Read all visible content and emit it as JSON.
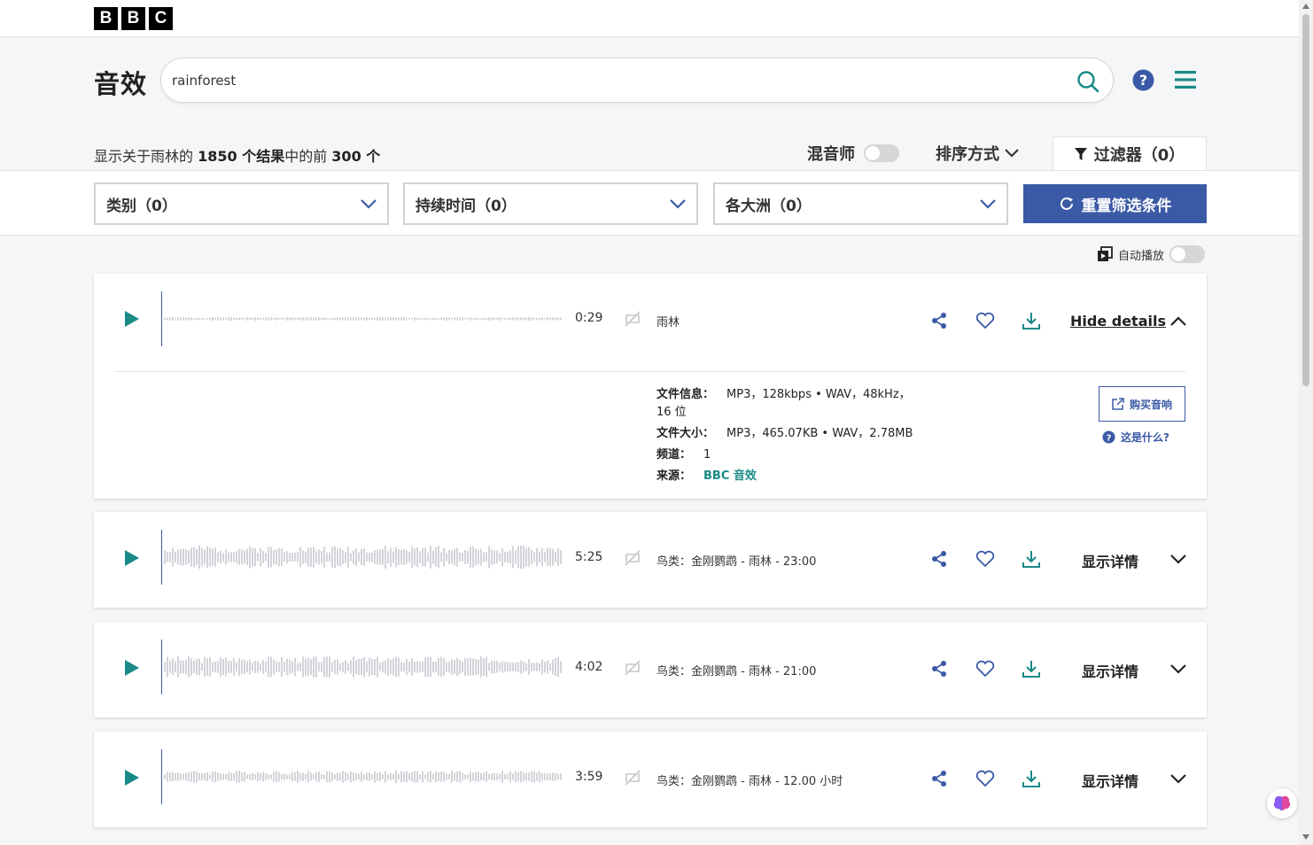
{
  "logo": [
    "B",
    "B",
    "C"
  ],
  "header": {
    "title": "音效",
    "search_value": "rainforest",
    "search_placeholder": ""
  },
  "results": {
    "prefix": "显示关于雨林的 ",
    "total": "1850 个结果",
    "middle": "中的前 ",
    "shown": "300 个"
  },
  "toolbar": {
    "mixer_label": "混音师",
    "sort_label": "排序方式",
    "filter_label": "过滤器（0）"
  },
  "filters": {
    "category": "类别（0）",
    "duration": "持续时间（0）",
    "continent": "各大洲（0）",
    "reset": "重置筛选条件"
  },
  "autoplay_label": "自动播放",
  "tracks": [
    {
      "duration": "0:29",
      "description": "雨林",
      "details_label": "Hide details",
      "expanded": true,
      "meta": {
        "file_info_label": "文件信息：",
        "file_info": "MP3，128kbps • WAV，48kHz，",
        "file_info_2": "16 位",
        "file_size_label": "文件大小：",
        "file_size": "MP3，465.07KB • WAV，2.78MB",
        "channels_label": "频道：",
        "channels": "1",
        "source_label": "来源：",
        "source": "BBC 音效"
      },
      "buy_label": "购买音响",
      "whatis_label": "这是什么?"
    },
    {
      "duration": "5:25",
      "description": "鸟类：金刚鹦鹉 - 雨林 - 23:00",
      "details_label": "显示详情",
      "expanded": false
    },
    {
      "duration": "4:02",
      "description": "鸟类：金刚鹦鹉 - 雨林 - 21:00",
      "details_label": "显示详情",
      "expanded": false
    },
    {
      "duration": "3:59",
      "description": "鸟类：金刚鹦鹉 - 雨林 - 12.00 小时",
      "details_label": "显示详情",
      "expanded": false
    }
  ],
  "colors": {
    "accent_blue": "#3b5aa6",
    "teal": "#1a8a87",
    "waveform": "#c8c8d0"
  }
}
